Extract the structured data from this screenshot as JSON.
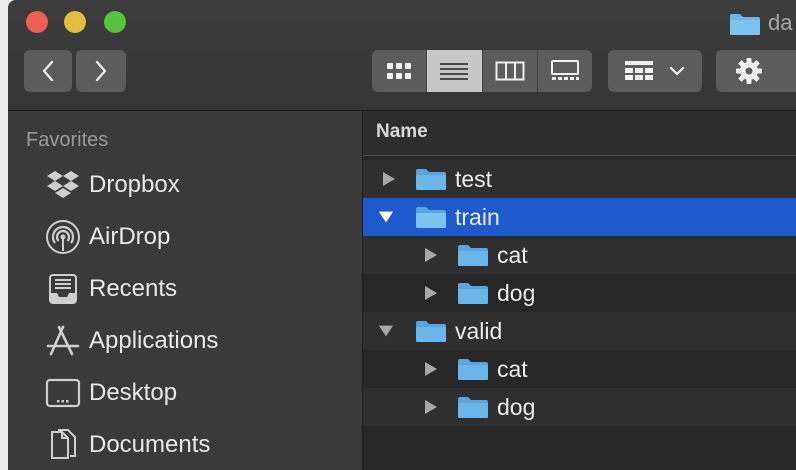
{
  "window": {
    "title": "da"
  },
  "toolbar": {
    "view_modes": [
      "icon",
      "list",
      "column",
      "gallery"
    ],
    "active_view": "list"
  },
  "sidebar": {
    "header": "Favorites",
    "items": [
      {
        "label": "Dropbox",
        "icon": "dropbox-icon"
      },
      {
        "label": "AirDrop",
        "icon": "airdrop-icon"
      },
      {
        "label": "Recents",
        "icon": "recents-icon"
      },
      {
        "label": "Applications",
        "icon": "applications-icon"
      },
      {
        "label": "Desktop",
        "icon": "desktop-icon"
      },
      {
        "label": "Documents",
        "icon": "documents-icon"
      }
    ]
  },
  "list": {
    "column_header": "Name",
    "rows": [
      {
        "name": "test",
        "level": 0,
        "expanded": false,
        "selected": false
      },
      {
        "name": "train",
        "level": 0,
        "expanded": true,
        "selected": true
      },
      {
        "name": "cat",
        "level": 1,
        "expanded": false,
        "selected": false
      },
      {
        "name": "dog",
        "level": 1,
        "expanded": false,
        "selected": false
      },
      {
        "name": "valid",
        "level": 0,
        "expanded": true,
        "selected": false
      },
      {
        "name": "cat",
        "level": 1,
        "expanded": false,
        "selected": false
      },
      {
        "name": "dog",
        "level": 1,
        "expanded": false,
        "selected": false
      }
    ]
  },
  "colors": {
    "selection": "#1f5acd",
    "folder": "#6bb6e8",
    "close": "#ed5f56",
    "minimize": "#e3bd3f",
    "maximize": "#59c23f"
  }
}
